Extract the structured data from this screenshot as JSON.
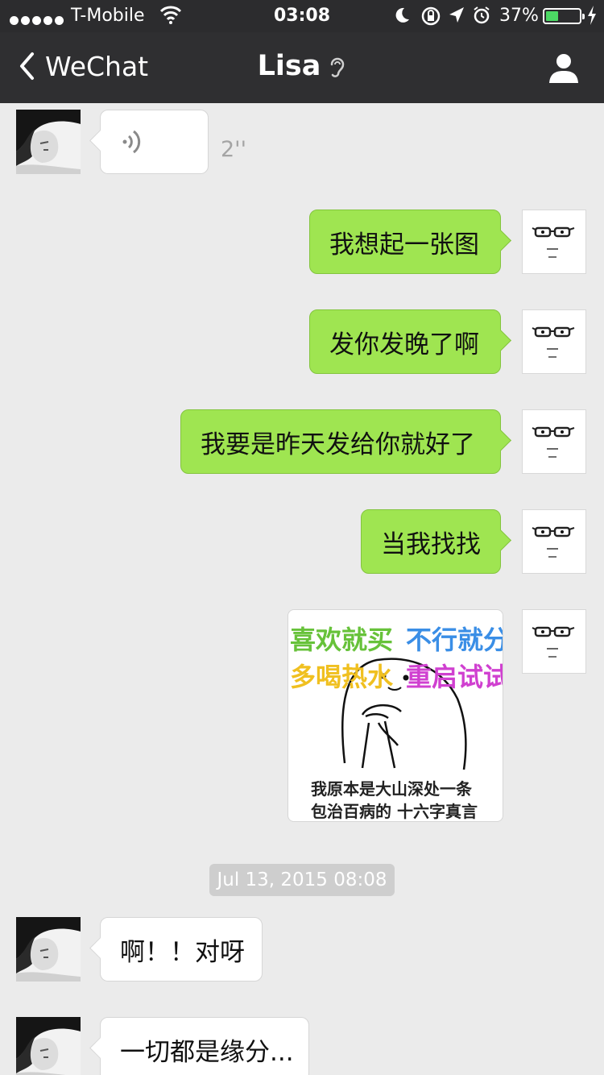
{
  "status_bar": {
    "carrier": "T-Mobile",
    "time": "03:08",
    "battery_percent": "37%",
    "battery_level": 0.37
  },
  "nav": {
    "back_label": "WeChat",
    "title": "Lisa"
  },
  "messages": {
    "voice": {
      "duration": "2''"
    },
    "out_1": "我想起一张图",
    "out_2": "发你发晚了啊",
    "out_3": "我要是昨天发给你就好了",
    "out_4": "当我找找",
    "sticker": {
      "line1_left": "喜欢就买",
      "line1_right": "不行就分",
      "line2_left": "多喝热水",
      "line2_right": "重启试试",
      "caption_1": "我原本是大山深处一条",
      "caption_2": "包治百病的 十六字真言"
    },
    "timestamp": "Jul 13, 2015 08:08",
    "in_1": "啊！！对呀",
    "in_2": "一切都是缘分..."
  },
  "colors": {
    "nav_bg": "#2f2f31",
    "chat_bg": "#ebebeb",
    "outgoing_bubble": "#9fe551",
    "incoming_bubble": "#ffffff",
    "battery_fill": "#4cd964"
  }
}
